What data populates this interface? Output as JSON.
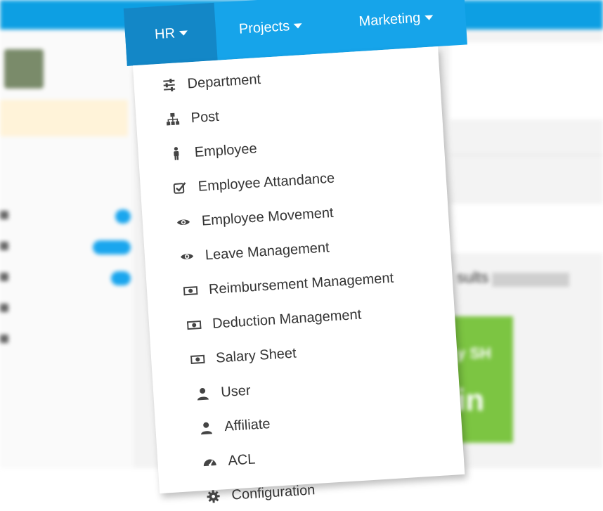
{
  "colors": {
    "topbar": "#16a4ea",
    "active_tab": "#1387c7",
    "menu_text": "#333333",
    "green_panel": "#7cc542"
  },
  "background": {
    "results_fragment": "sults",
    "green_fragment_1": "y SH",
    "green_fragment_2": "in"
  },
  "menubar": {
    "items": [
      {
        "label": "HR",
        "active": true
      },
      {
        "label": "Projects",
        "active": false
      },
      {
        "label": "Marketing",
        "active": false
      }
    ]
  },
  "hr_menu": {
    "items": [
      {
        "label": "Department",
        "icon": "sliders-icon"
      },
      {
        "label": "Post",
        "icon": "sitemap-icon"
      },
      {
        "label": "Employee",
        "icon": "male-icon"
      },
      {
        "label": "Employee Attandance",
        "icon": "checkbox-icon"
      },
      {
        "label": "Employee Movement",
        "icon": "eye-icon"
      },
      {
        "label": "Leave Management",
        "icon": "eye-icon"
      },
      {
        "label": "Reimbursement Management",
        "icon": "money-icon"
      },
      {
        "label": "Deduction Management",
        "icon": "money-icon"
      },
      {
        "label": "Salary Sheet",
        "icon": "money-icon"
      },
      {
        "label": "User",
        "icon": "user-icon"
      },
      {
        "label": "Affiliate",
        "icon": "user-icon"
      },
      {
        "label": "ACL",
        "icon": "dashboard-icon"
      },
      {
        "label": "Configuration",
        "icon": "gear-icon"
      }
    ]
  }
}
